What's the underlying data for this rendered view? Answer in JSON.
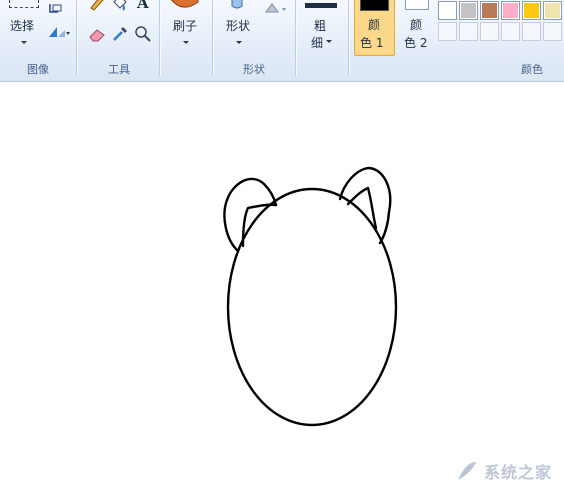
{
  "groups": {
    "image": {
      "label": "图像",
      "select_label": "选择"
    },
    "tools": {
      "label": "工具",
      "text_tool_glyph": "A"
    },
    "brushes": {
      "label": "刷子"
    },
    "shapes": {
      "label": "形状",
      "shapes_button_label": "形状"
    },
    "size": {
      "label_line1": "粗",
      "label_line2": "细"
    },
    "colors": {
      "label": "颜色",
      "color1_line1": "颜",
      "color1_line2": "色 1",
      "color2_line1": "颜",
      "color2_line2": "色 2",
      "color1_value": "#000000",
      "color2_value": "#ffffff",
      "palette": [
        {
          "name": "white",
          "color": "#ffffff"
        },
        {
          "name": "light-gray",
          "color": "#c3c3c3"
        },
        {
          "name": "brown",
          "color": "#b97a57"
        },
        {
          "name": "pink",
          "color": "#ffaec9"
        },
        {
          "name": "gold",
          "color": "#ffc90e"
        },
        {
          "name": "light-yellow",
          "color": "#efe4b0"
        }
      ]
    }
  },
  "icons": [
    "select-icon",
    "crop-icon",
    "rotate-icon",
    "pencil-icon",
    "fill-icon",
    "text-icon",
    "eraser-icon",
    "color-picker-icon",
    "magnifier-icon",
    "brush-icon",
    "shapes-icon",
    "outline-icon",
    "size-icon"
  ],
  "watermark": {
    "text": "系统之家"
  }
}
